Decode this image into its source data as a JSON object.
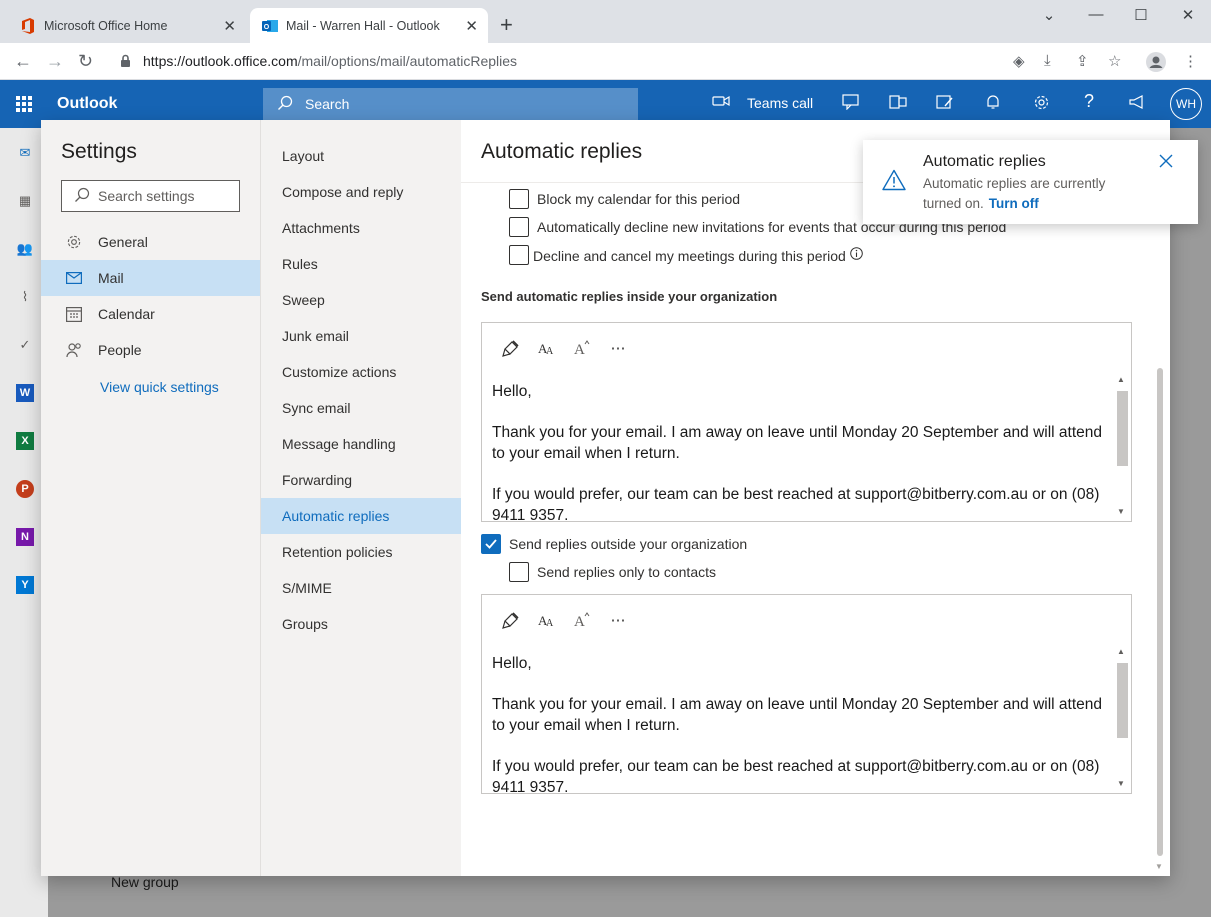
{
  "browser": {
    "tabs": [
      {
        "title": "Microsoft Office Home",
        "icon": "office-icon"
      },
      {
        "title": "Mail - Warren Hall - Outlook",
        "icon": "outlook-icon"
      }
    ],
    "url_host": "https://outlook.office.com",
    "url_path": "/mail/options/mail/automaticReplies"
  },
  "header": {
    "app_name": "Outlook",
    "search_placeholder": "Search",
    "teams_call": "Teams call",
    "avatar_initials": "WH"
  },
  "background": {
    "new_group": "New group"
  },
  "settings": {
    "title": "Settings",
    "search_placeholder": "Search settings",
    "categories": [
      {
        "label": "General",
        "icon": "gear-icon"
      },
      {
        "label": "Mail",
        "icon": "mail-icon"
      },
      {
        "label": "Calendar",
        "icon": "calendar-icon"
      },
      {
        "label": "People",
        "icon": "people-icon"
      }
    ],
    "view_quick_settings": "View quick settings",
    "mail_subitems": [
      "Layout",
      "Compose and reply",
      "Attachments",
      "Rules",
      "Sweep",
      "Junk email",
      "Customize actions",
      "Sync email",
      "Message handling",
      "Forwarding",
      "Automatic replies",
      "Retention policies",
      "S/MIME",
      "Groups"
    ]
  },
  "panel": {
    "title": "Automatic replies",
    "options": {
      "block_calendar": "Block my calendar for this period",
      "decline_invitations": "Automatically decline new invitations for events that occur during this period",
      "decline_cancel": "Decline and cancel my meetings during this period"
    },
    "inside_heading": "Send automatic replies inside your organization",
    "inside_message": {
      "greeting": "Hello,",
      "line1": "Thank you for your email. I am away on leave until Monday 20 September and will attend to your email when I return.",
      "line2": "If you would prefer, our team can be best reached at support@bitberry.com.au or on (08) 9411 9357."
    },
    "outside_label": "Send replies outside your organization",
    "outside_checked": true,
    "contacts_only_label": "Send replies only to contacts",
    "outside_message": {
      "greeting": "Hello,",
      "line1": "Thank you for your email. I am away on leave until Monday 20 September and will attend to your email when I return.",
      "line2": "If you would prefer, our team can be best reached at support@bitberry.com.au or on (08) 9411 9357."
    }
  },
  "toast": {
    "title": "Automatic replies",
    "body": "Automatic replies are currently turned on.",
    "link": "Turn off"
  },
  "colors": {
    "brand_blue": "#0f6cbd",
    "selected_bg": "#c7e0f4"
  }
}
